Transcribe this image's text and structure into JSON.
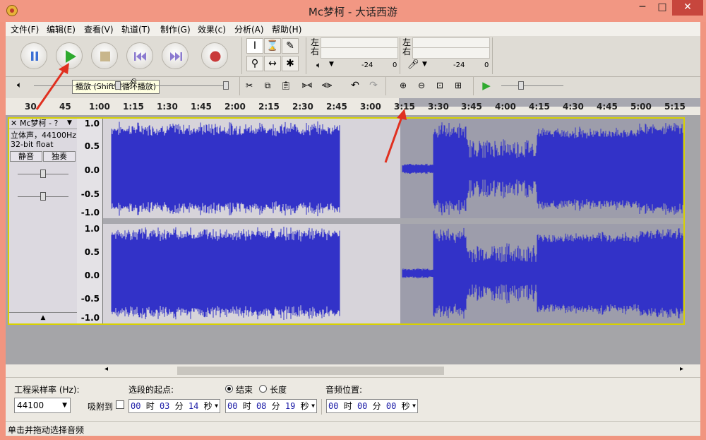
{
  "window": {
    "title": "Mc梦柯 - 大话西游",
    "close_glyph": "✕",
    "min_glyph": "─",
    "max_glyph": "□"
  },
  "menu": [
    "文件(F)",
    "编辑(E)",
    "查看(V)",
    "轨道(T)",
    "制作(G)",
    "效果(c)",
    "分析(A)",
    "帮助(H)"
  ],
  "transport": {
    "tooltip": "播放 (Shift键循环播放)",
    "buttons": [
      "pause-button",
      "play-button",
      "stop-button",
      "skip-start-button",
      "skip-end-button",
      "record-button"
    ]
  },
  "meters": {
    "left_label": "左",
    "right_label": "右",
    "play_ticks": [
      "-24",
      "0"
    ],
    "rec_ticks": [
      "-24",
      "0"
    ]
  },
  "ruler": {
    "labels": [
      "30",
      "45",
      "1:00",
      "1:15",
      "1:30",
      "1:45",
      "2:00",
      "2:15",
      "2:30",
      "2:45",
      "3:00",
      "3:15",
      "3:30",
      "3:45",
      "4:00",
      "4:15",
      "4:30",
      "4:45",
      "5:00",
      "5:15"
    ]
  },
  "track": {
    "name": "Mc梦柯 - ?",
    "info_line1": "立体声，44100Hz",
    "info_line2": "32-bit float",
    "mute_label": "静音",
    "solo_label": "独奏",
    "vscale": [
      "1.0",
      "0.5",
      "0.0",
      "-0.5",
      "-1.0"
    ]
  },
  "bottom": {
    "rate_label": "工程采样率 (Hz):",
    "rate_value": "44100",
    "snap_label": "吸附到",
    "sel_start_label": "选段的起点:",
    "end_label": "结束",
    "length_label": "长度",
    "audio_pos_label": "音频位置:",
    "sel_start": {
      "h": "00",
      "m": "03",
      "s": "14"
    },
    "sel_end": {
      "h": "00",
      "m": "08",
      "s": "19"
    },
    "audio_pos": {
      "h": "00",
      "m": "00",
      "s": "00"
    },
    "unit_h": "时",
    "unit_m": "分",
    "unit_s": "秒"
  },
  "status": {
    "text": "单击并拖动选择音频"
  },
  "colors": {
    "wave": "#3232c8",
    "wave_sel": "#6b6bd6",
    "selection_bg": "#9d9dab"
  }
}
